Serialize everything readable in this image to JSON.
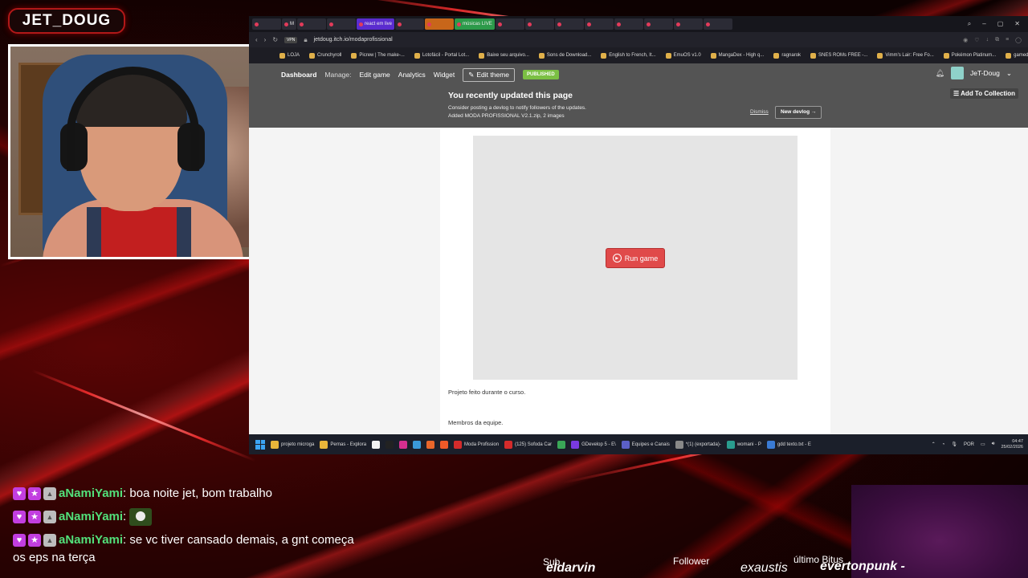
{
  "overlay": {
    "streamer_name": "JET_DOUG"
  },
  "browser": {
    "tabs": [
      {
        "label": "",
        "style": ""
      },
      {
        "label": "M",
        "style": ""
      },
      {
        "label": "",
        "style": ""
      },
      {
        "label": "",
        "style": ""
      },
      {
        "label": "react em live",
        "style": "purple"
      },
      {
        "label": "",
        "style": ""
      },
      {
        "label": "",
        "style": "orange"
      },
      {
        "label": "músicas LIVE",
        "style": "green"
      },
      {
        "label": "",
        "style": ""
      },
      {
        "label": "",
        "style": ""
      },
      {
        "label": "",
        "style": ""
      },
      {
        "label": "",
        "style": ""
      },
      {
        "label": "",
        "style": ""
      },
      {
        "label": "",
        "style": ""
      },
      {
        "label": "",
        "style": ""
      },
      {
        "label": "",
        "style": ""
      }
    ],
    "address": {
      "vpn": "VPN",
      "url": "jetdoug.itch.io/modaprofissional"
    },
    "bookmarks": [
      "LOJA",
      "Crunchyroll",
      "Picrew | The make-...",
      "Lotofácil - Portal Lot...",
      "Baixe seu arquivo...",
      "Sons de Download...",
      "English to French, It...",
      "EmuOS v1.0",
      "MangaDex - High q...",
      "ragnarok",
      "SNES ROMs FREE -...",
      "Vimm's Lair: Free Fo...",
      "Pokémon Platinum...",
      "gamedevs"
    ]
  },
  "itch": {
    "nav": {
      "dashboard": "Dashboard",
      "manage": "Manage:",
      "edit_game": "Edit game",
      "analytics": "Analytics",
      "widget": "Widget",
      "edit_theme": "Edit theme",
      "published": "PUBLISHED"
    },
    "user": {
      "name": "JeT-Doug"
    },
    "notice": {
      "title": "You recently updated this page",
      "line1": "Consider posting a devlog to notify followers of the updates.",
      "line2": "Added MODA PROFISSIONAL V2.1.zip, 2 images",
      "dismiss": "Dismiss",
      "new_devlog": "New devlog →"
    },
    "add_to_collection": "Add To Collection",
    "game": {
      "run_label": "Run game"
    },
    "description": {
      "line1": "Projeto feito durante o curso.",
      "line2": "Membros da equipe."
    }
  },
  "taskbar": {
    "items": [
      {
        "label": "projeto microga",
        "color": "#e8b53a"
      },
      {
        "label": "Pernas - Explora",
        "color": "#e8b53a"
      },
      {
        "label": "",
        "color": "#f2f2f2"
      },
      {
        "label": "",
        "color": "#222222"
      },
      {
        "label": "",
        "color": "#d62f8f"
      },
      {
        "label": "",
        "color": "#3a9ad9"
      },
      {
        "label": "",
        "color": "#e8662a"
      },
      {
        "label": "",
        "color": "#f05a28"
      },
      {
        "label": "Moda Profission",
        "color": "#d42b2b"
      },
      {
        "label": "(125) Sofoda Car",
        "color": "#d42b2b"
      },
      {
        "label": "",
        "color": "#3aa757"
      },
      {
        "label": "GDevelop 5 - E\\",
        "color": "#7a3ae0"
      },
      {
        "label": "Equipes e Canais",
        "color": "#5b5fc7"
      },
      {
        "label": "*(1) (exportada)-",
        "color": "#888888"
      },
      {
        "label": "womani - P",
        "color": "#2a9d8f"
      },
      {
        "label": "gdd texto.txt - E",
        "color": "#3a7bd5"
      }
    ],
    "language": "POR",
    "time": "04:47",
    "date": "25/02/2026"
  },
  "chat": {
    "messages": [
      {
        "user": "aNamiYami",
        "text": "boa noite jet, bom trabalho",
        "emote": false
      },
      {
        "user": "aNamiYami",
        "text": "",
        "emote": true
      },
      {
        "user": "aNamiYami",
        "text": "se vc tiver cansado demais, a gnt começa os eps na terça",
        "emote": false
      }
    ]
  },
  "bottom_bar": {
    "sub_label": "Sub",
    "sub_name": "eldarvin",
    "follower_label": "Follower",
    "follower_name": "exaustis",
    "bits_label": "último Bitus",
    "bits_name": "evertonpunk -"
  }
}
